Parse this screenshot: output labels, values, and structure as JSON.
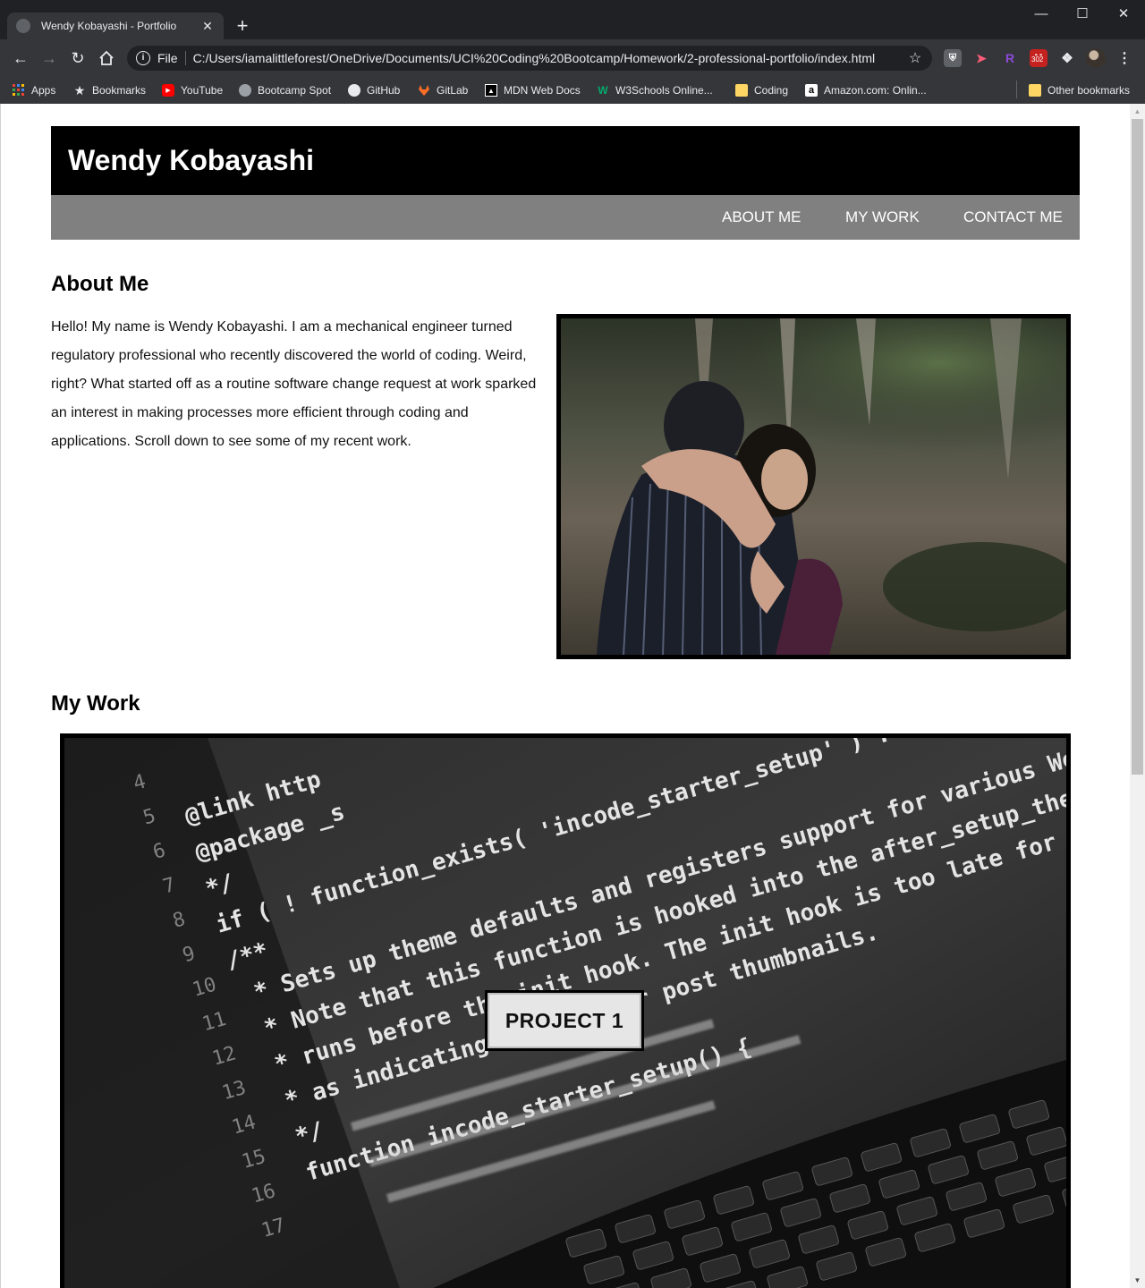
{
  "browser": {
    "tab_title": "Wendy Kobayashi - Portfolio",
    "tab_close": "✕",
    "new_tab": "+",
    "scheme_label": "File",
    "url": "C:/Users/iamalittleforest/OneDrive/Documents/UCI%20Coding%20Bootcamp/Homework/2-professional-portfolio/index.html",
    "extension_badge": "302",
    "bookmarks": [
      {
        "label": "Apps",
        "icon": "apps-grid-icon"
      },
      {
        "label": "Bookmarks",
        "icon": "star-icon"
      },
      {
        "label": "YouTube",
        "icon": "youtube-icon"
      },
      {
        "label": "Bootcamp Spot",
        "icon": "globe-icon"
      },
      {
        "label": "GitHub",
        "icon": "github-icon"
      },
      {
        "label": "GitLab",
        "icon": "gitlab-icon"
      },
      {
        "label": "MDN Web Docs",
        "icon": "mdn-icon"
      },
      {
        "label": "W3Schools Online...",
        "icon": "w3schools-icon"
      },
      {
        "label": "Coding",
        "icon": "folder-icon"
      },
      {
        "label": "Amazon.com: Onlin...",
        "icon": "amazon-icon"
      },
      {
        "label": "Other bookmarks",
        "icon": "folder-icon"
      }
    ]
  },
  "page": {
    "site_title": "Wendy Kobayashi",
    "nav": [
      {
        "label": "ABOUT ME"
      },
      {
        "label": "MY WORK"
      },
      {
        "label": "CONTACT ME"
      }
    ],
    "about": {
      "heading": "About Me",
      "body": "Hello! My name is Wendy Kobayashi. I am a mechanical engineer turned regulatory professional who recently discovered the world of coding. Weird, right? What started off as a routine software change request at work sparked an interest in making processes more efficient through coding and applications. Scroll down to see some of my recent work."
    },
    "work": {
      "heading": "My Work",
      "project_label": "PROJECT 1",
      "code_lines": [
        "@link http",
        "@package _s",
        "*/",
        "if ( ! function_exists( 'incode_starter_setup' ) :",
        "/**",
        "* Sets up theme defaults and registers support for various WordPress",
        "* Note that this function is hooked into the after_setup_theme hook, which",
        "* runs before the init hook. The init hook is too late for some features, such",
        "* as indicating support for post thumbnails.",
        "*/",
        "function incode_starter_setup() {"
      ],
      "line_numbers": [
        "4",
        "5",
        "6",
        "7",
        "8",
        "9",
        "10",
        "11",
        "12",
        "13",
        "14",
        "15",
        "16",
        "17"
      ]
    }
  },
  "colors": {
    "header_bg": "#000000",
    "nav_bg": "#808080",
    "chrome_bg": "#35363a",
    "tabstrip_bg": "#202124"
  }
}
